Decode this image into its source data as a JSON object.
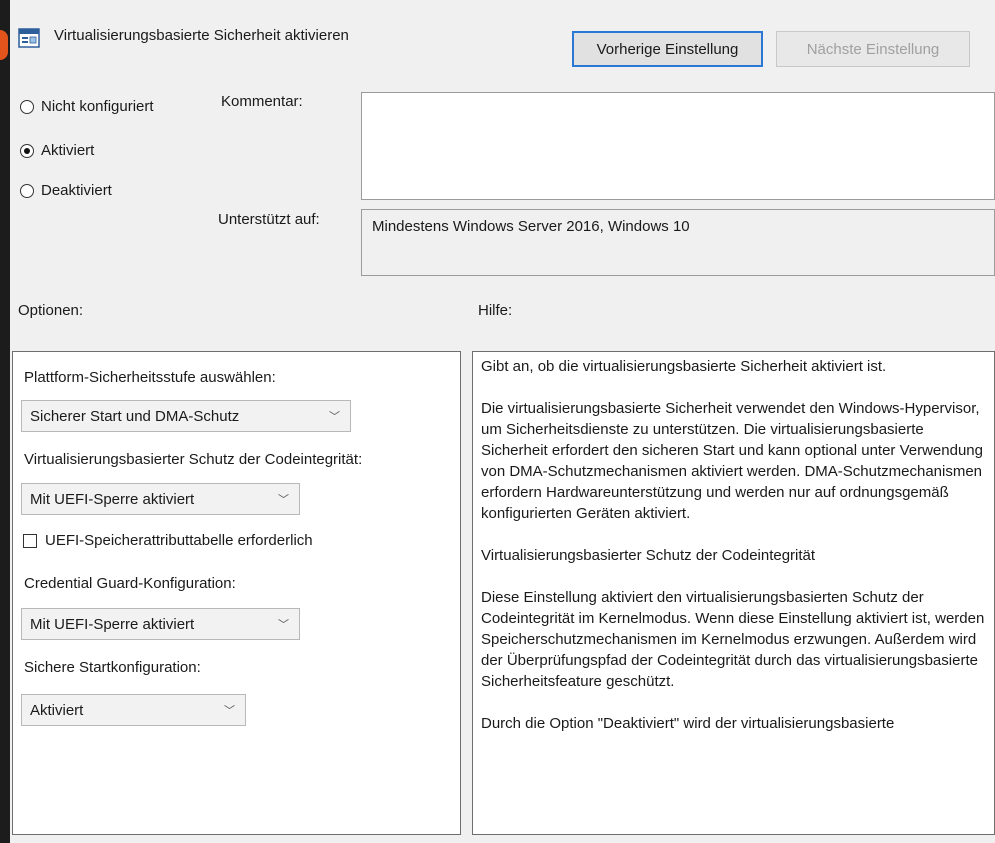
{
  "window": {
    "title": "Virtualisierungsbasierte Sicherheit aktivieren",
    "prev_button": "Vorherige Einstellung",
    "next_button": "Nächste Einstellung"
  },
  "state": {
    "options": [
      "Nicht konfiguriert",
      "Aktiviert",
      "Deaktiviert"
    ],
    "selected": "Aktiviert"
  },
  "comment": {
    "label": "Kommentar:",
    "value": ""
  },
  "supported": {
    "label": "Unterstützt auf:",
    "value": "Mindestens Windows Server 2016, Windows 10"
  },
  "options": {
    "heading": "Optionen:",
    "platform_label": "Plattform-Sicherheitsstufe auswählen:",
    "platform_value": "Sicherer Start und DMA-Schutz",
    "code_integrity_label": "Virtualisierungsbasierter Schutz der Codeintegrität:",
    "code_integrity_value": "Mit UEFI-Sperre aktiviert",
    "uefi_table_label": "UEFI-Speicherattributtabelle erforderlich",
    "uefi_table_checked": false,
    "credential_guard_label": "Credential Guard-Konfiguration:",
    "credential_guard_value": "Mit UEFI-Sperre aktiviert",
    "secure_launch_label": "Sichere Startkonfiguration:",
    "secure_launch_value": "Aktiviert"
  },
  "help": {
    "heading": "Hilfe:",
    "paragraphs": [
      "Gibt an, ob die virtualisierungsbasierte Sicherheit aktiviert ist.",
      "Die virtualisierungsbasierte Sicherheit verwendet den Windows-Hypervisor, um Sicherheitsdienste zu unterstützen. Die virtualisierungsbasierte Sicherheit erfordert den sicheren Start und kann optional unter Verwendung von DMA-Schutzmechanismen aktiviert werden. DMA-Schutzmechanismen erfordern Hardwareunterstützung und werden nur auf ordnungsgemäß konfigurierten Geräten aktiviert.",
      "Virtualisierungsbasierter Schutz der Codeintegrität",
      "Diese Einstellung aktiviert den virtualisierungsbasierten Schutz der Codeintegrität im Kernelmodus. Wenn diese Einstellung aktiviert ist, werden Speicherschutzmechanismen im Kernelmodus erzwungen. Außerdem wird der Überprüfungspfad der Codeintegrität durch das virtualisierungsbasierte Sicherheitsfeature geschützt.",
      "Durch die Option \"Deaktiviert\" wird der virtualisierungsbasierte"
    ]
  },
  "icons": {
    "app": "policy-setting-icon",
    "dropdown": "chevron-down-icon"
  }
}
